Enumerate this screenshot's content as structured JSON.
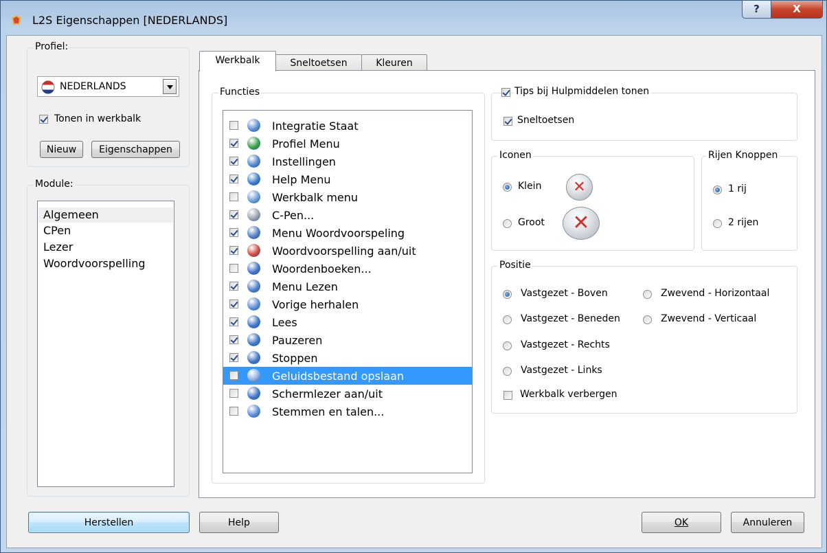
{
  "window": {
    "title": "L2S Eigenschappen [NEDERLANDS]",
    "help_glyph": "?",
    "close_glyph": "X"
  },
  "profile": {
    "group_label": "Profiel:",
    "selected": "NEDERLANDS",
    "show_in_toolbar_label": "Tonen in werkbalk",
    "show_in_toolbar_checked": true,
    "new_label": "Nieuw",
    "properties_label": "Eigenschappen"
  },
  "module": {
    "group_label": "Module:",
    "items": [
      "Algemeen",
      "CPen",
      "Lezer",
      "Woordvoorspelling"
    ],
    "selected_index": 0
  },
  "tabs": [
    {
      "label": "Werkbalk",
      "active": true
    },
    {
      "label": "Sneltoetsen",
      "active": false
    },
    {
      "label": "Kleuren",
      "active": false
    }
  ],
  "functions": {
    "group_label": "Functies",
    "items": [
      {
        "label": "Integratie Staat",
        "checked": false,
        "icon": "info-icon",
        "color": "#5b8fd6"
      },
      {
        "label": "Profiel Menu",
        "checked": true,
        "icon": "globe-icon",
        "color": "#3aa24a"
      },
      {
        "label": "Instellingen",
        "checked": true,
        "icon": "settings-icon",
        "color": "#4f86cf"
      },
      {
        "label": "Help Menu",
        "checked": true,
        "icon": "help-icon",
        "color": "#3c7bd0"
      },
      {
        "label": "Werkbalk menu",
        "checked": false,
        "icon": "toolbar-icon",
        "color": "#6aa0dc"
      },
      {
        "label": "C-Pen...",
        "checked": true,
        "icon": "pen-icon",
        "color": "#9aa4b0"
      },
      {
        "label": "Menu Woordvoorspeling",
        "checked": true,
        "icon": "menu-icon",
        "color": "#4f7fc8"
      },
      {
        "label": "Woordvoorspelling aan/uit",
        "checked": true,
        "icon": "toggle-icon",
        "color": "#d24b3e"
      },
      {
        "label": "Woordenboeken...",
        "checked": false,
        "icon": "dictionary-icon",
        "color": "#3f77c9"
      },
      {
        "label": "Menu Lezen",
        "checked": true,
        "icon": "menu-icon",
        "color": "#4f7fc8"
      },
      {
        "label": "Vorige herhalen",
        "checked": true,
        "icon": "repeat-icon",
        "color": "#5a8fd9"
      },
      {
        "label": "Lees",
        "checked": true,
        "icon": "play-icon",
        "color": "#3f77c9"
      },
      {
        "label": "Pauzeren",
        "checked": true,
        "icon": "pause-icon",
        "color": "#3f77c9"
      },
      {
        "label": "Stoppen",
        "checked": true,
        "icon": "stop-icon",
        "color": "#3f77c9"
      },
      {
        "label": "Geluidsbestand opslaan",
        "checked": false,
        "icon": "save-audio-icon",
        "color": "#8fb3e3",
        "selected": true
      },
      {
        "label": "Schermlezer aan/uit",
        "checked": false,
        "icon": "screen-reader-icon",
        "color": "#3f77c9"
      },
      {
        "label": "Stemmen en talen...",
        "checked": false,
        "icon": "voices-icon",
        "color": "#5a8fd9"
      }
    ]
  },
  "options": {
    "tooltips_label": "Tips bij Hulpmiddelen tonen",
    "tooltips_checked": true,
    "shortcuts_label": "Sneltoetsen",
    "shortcuts_checked": true
  },
  "icons_group": {
    "label": "Iconen",
    "small_label": "Klein",
    "large_label": "Groot",
    "selected": "Klein",
    "sample_glyph": "✕"
  },
  "rows_group": {
    "label": "Rijen Knoppen",
    "one_row_label": "1 rij",
    "two_rows_label": "2 rijen",
    "selected": "1 rij"
  },
  "position_group": {
    "label": "Positie",
    "options": [
      "Vastgezet - Boven",
      "Vastgezet - Beneden",
      "Vastgezet - Rechts",
      "Vastgezet - Links",
      "Zwevend - Horizontaal",
      "Zwevend - Verticaal"
    ],
    "selected": "Vastgezet - Boven",
    "hide_toolbar_label": "Werkbalk verbergen",
    "hide_toolbar_checked": false
  },
  "buttons": {
    "restore": "Herstellen",
    "help": "Help",
    "ok": "OK",
    "cancel": "Annuleren"
  }
}
